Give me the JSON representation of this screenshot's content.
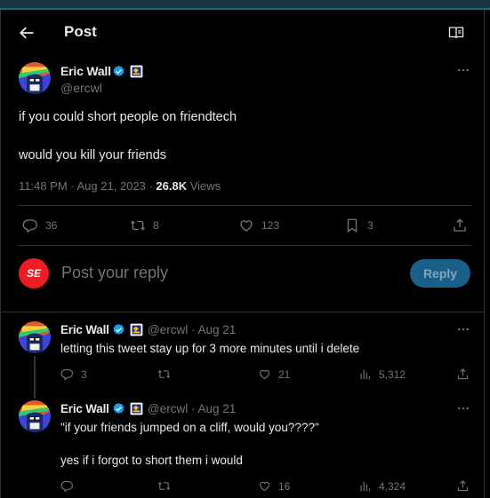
{
  "header": {
    "title": "Post"
  },
  "post": {
    "author": "Eric Wall",
    "handle": "@ercwl",
    "text_line1": "if you could short people on friendtech",
    "text_line2": "would you kill your friends",
    "timestamp": "11:48 PM · Aug 21, 2023 · ",
    "views": "26.8K",
    "views_label": " Views",
    "counts": {
      "replies": "36",
      "reposts": "8",
      "likes": "123",
      "bookmarks": "3"
    }
  },
  "composer": {
    "avatar_text": "SE",
    "placeholder": "Post your reply",
    "button_label": "Reply"
  },
  "replies": [
    {
      "author": "Eric Wall",
      "handle_date": "@ercwl · Aug 21",
      "text": "letting this tweet stay up for 3 more minutes until i delete",
      "counts": {
        "replies": "3",
        "reposts": "",
        "likes": "21",
        "views": "5,312"
      }
    },
    {
      "author": "Eric Wall",
      "handle_date": "@ercwl · Aug 21",
      "text_line1": "\"if your friends jumped on a cliff, would you????\"",
      "text_line2": "yes if i forgot to short them i would",
      "counts": {
        "replies": "",
        "reposts": "",
        "likes": "16",
        "views": "4,324"
      }
    }
  ],
  "colors": {
    "accent": "#1d9bf0",
    "reply_button": "#1a5f8a",
    "muted": "#71767b",
    "composer_avatar": "#ee1d23"
  },
  "icons": [
    "back-arrow-icon",
    "reader-mode-icon",
    "verified-icon",
    "affiliate-badge-icon",
    "more-icon",
    "reply-icon",
    "repost-icon",
    "like-icon",
    "bookmark-icon",
    "share-icon",
    "views-icon"
  ]
}
